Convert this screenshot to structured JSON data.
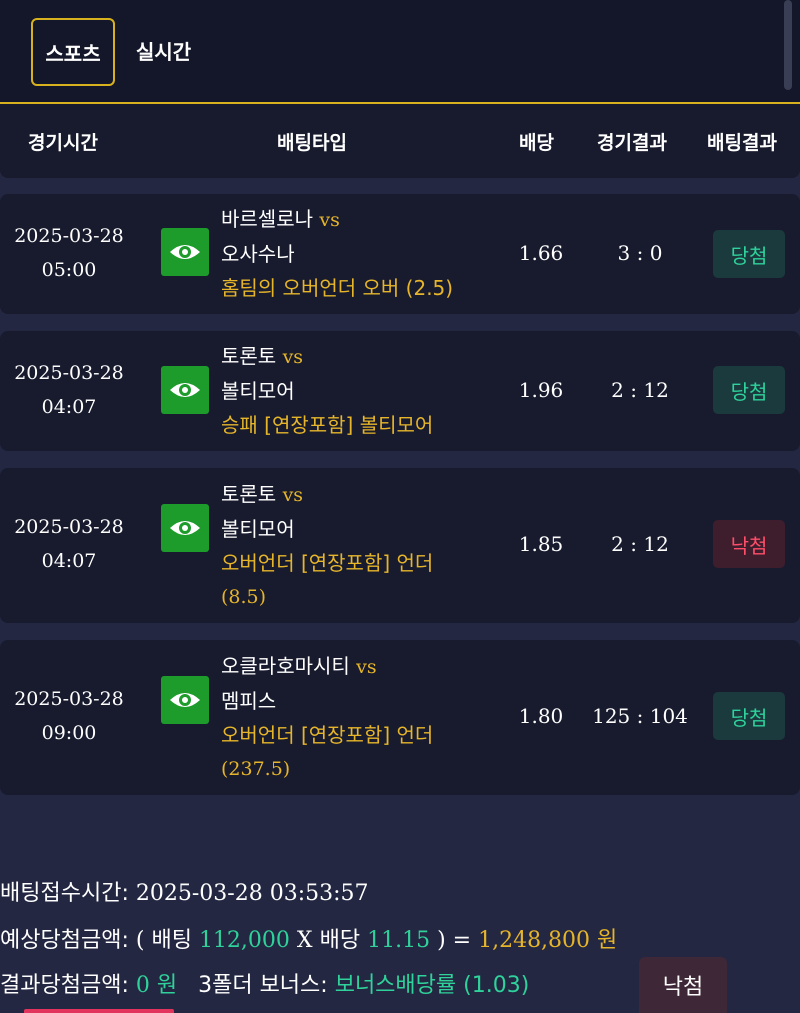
{
  "tabs": {
    "sports": "스포츠",
    "live": "실시간"
  },
  "headers": {
    "time": "경기시간",
    "type": "배팅타입",
    "odds": "배당",
    "score": "경기결과",
    "result": "배팅결과"
  },
  "vs": "vs",
  "rows": [
    {
      "date": "2025-03-28",
      "time": "05:00",
      "home": "바르셀로나",
      "away": "오사수나",
      "bet_line1": "홈팀의 오버언더 오버 (2.5)",
      "bet_line2": "",
      "odds": "1.66",
      "score": "3 : 0",
      "result": "당첨"
    },
    {
      "date": "2025-03-28",
      "time": "04:07",
      "home": "토론토",
      "away": "볼티모어",
      "bet_line1": "승패 [연장포함] 볼티모어",
      "bet_line2": "",
      "odds": "1.96",
      "score": "2 : 12",
      "result": "당첨"
    },
    {
      "date": "2025-03-28",
      "time": "04:07",
      "home": "토론토",
      "away": "볼티모어",
      "bet_line1": "오버언더 [연장포함] 언더",
      "bet_line2": "(8.5)",
      "odds": "1.85",
      "score": "2 : 12",
      "result": "낙첨"
    },
    {
      "date": "2025-03-28",
      "time": "09:00",
      "home": "오클라호마시티",
      "away": "멤피스",
      "bet_line1": "오버언더 [연장포함] 언더",
      "bet_line2": "(237.5)",
      "odds": "1.80",
      "score": "125 : 104",
      "result": "당첨"
    }
  ],
  "summary": {
    "received_label": "배팅접수시간:",
    "received_value": "2025-03-28 03:53:57",
    "expected_label": "예상당첨금액:",
    "open_paren": "(",
    "bet_label": "배팅",
    "bet_amount": "112,000",
    "times": "X",
    "odds_label": "배당",
    "total_odds": "11.15",
    "close_eq": ") =",
    "expected_amount": "1,248,800",
    "won": "원",
    "result_label": "결과당첨금액:",
    "result_amount": "0",
    "result_won": "원",
    "bonus_label": "3폴더 보너스:",
    "bonus_value": "보너스배당률 (1.03)",
    "status": "낙첨"
  },
  "colors": {
    "accent_gold": "#d8b21e",
    "win_green": "#2fd29a",
    "lose_red": "#ff4e6a",
    "eye_green": "#1d9b2b"
  },
  "icons": {
    "view": "eye-icon"
  }
}
